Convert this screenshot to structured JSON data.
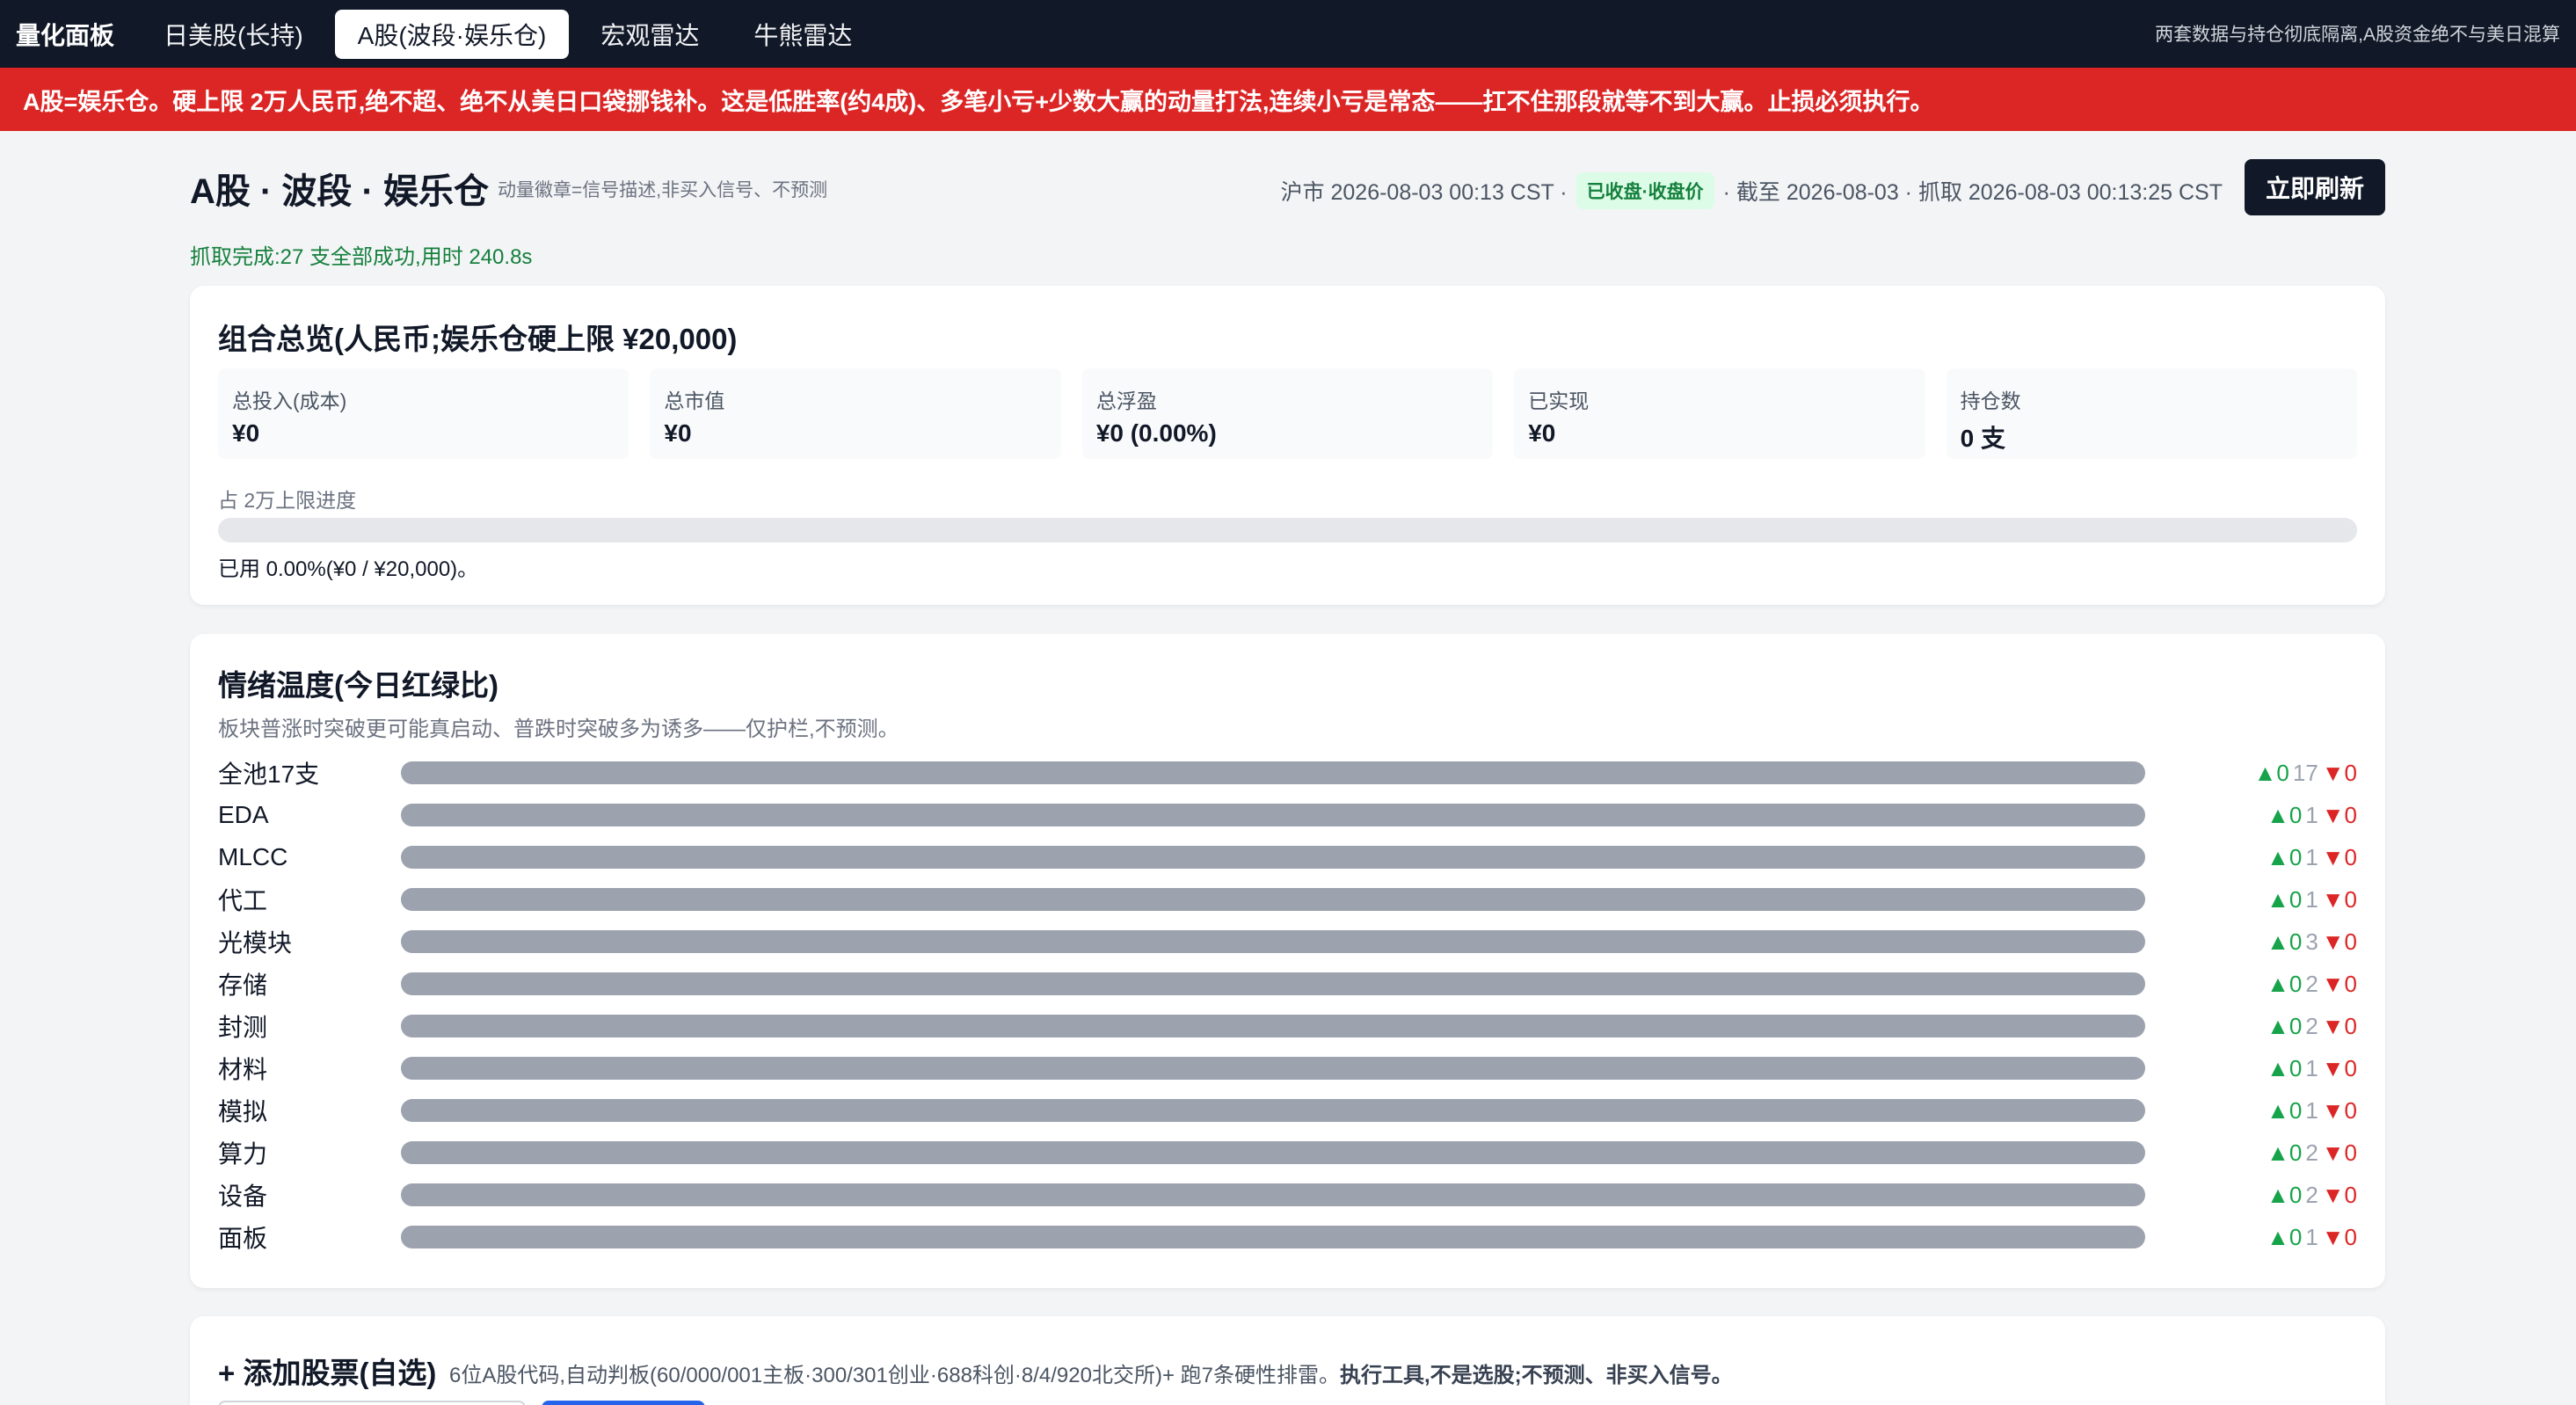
{
  "nav": {
    "brand": "量化面板",
    "tabs": [
      {
        "label": "日美股(长持)"
      },
      {
        "label": "A股(波段·娱乐仓)"
      },
      {
        "label": "宏观雷达"
      },
      {
        "label": "牛熊雷达"
      }
    ],
    "active_tab": "A股(波段·娱乐仓)",
    "note": "两套数据与持仓彻底隔离,A股资金绝不与美日混算"
  },
  "banner": {
    "text": "A股=娱乐仓。硬上限 2万人民币,绝不超、绝不从美日口袋挪钱补。这是低胜率(约4成)、多笔小亏+少数大赢的动量打法,连续小亏是常态——扛不住那段就等不到大赢。止损必须执行。"
  },
  "header": {
    "title": "A股 · 波段 · 娱乐仓",
    "subtitle": "动量徽章=信号描述,非买入信号、不预测",
    "market_time": "沪市 2026-08-03 00:13 CST ·",
    "market_status": "已收盘·收盘价",
    "as_of": "· 截至 2026-08-03 · 抓取 2026-08-03 00:13:25 CST",
    "refresh_label": "立即刷新",
    "fetch_status": "抓取完成:27 支全部成功,用时 240.8s"
  },
  "portfolio": {
    "title": "组合总览(人民币;娱乐仓硬上限 ¥20,000)",
    "stats": [
      {
        "label": "总投入(成本)",
        "value": "¥0"
      },
      {
        "label": "总市值",
        "value": "¥0"
      },
      {
        "label": "总浮盈",
        "value": "¥0 (0.00%)"
      },
      {
        "label": "已实现",
        "value": "¥0"
      },
      {
        "label": "持仓数",
        "value": "0 支"
      }
    ],
    "progress_label": "占 2万上限进度",
    "progress_fraction": 0.0,
    "progress_note": "已用 0.00%(¥0 / ¥20,000)。"
  },
  "sentiment": {
    "title": "情绪温度(今日红绿比)",
    "subtitle": "板块普涨时突破更可能真启动、普跌时突破多为诱多——仅护栏,不预测。",
    "rows": [
      {
        "label": "全池17支",
        "up": "▲0",
        "flat": "17",
        "down": "▼0"
      },
      {
        "label": "EDA",
        "up": "▲0",
        "flat": "1",
        "down": "▼0"
      },
      {
        "label": "MLCC",
        "up": "▲0",
        "flat": "1",
        "down": "▼0"
      },
      {
        "label": "代工",
        "up": "▲0",
        "flat": "1",
        "down": "▼0"
      },
      {
        "label": "光模块",
        "up": "▲0",
        "flat": "3",
        "down": "▼0"
      },
      {
        "label": "存储",
        "up": "▲0",
        "flat": "2",
        "down": "▼0"
      },
      {
        "label": "封测",
        "up": "▲0",
        "flat": "2",
        "down": "▼0"
      },
      {
        "label": "材料",
        "up": "▲0",
        "flat": "1",
        "down": "▼0"
      },
      {
        "label": "模拟",
        "up": "▲0",
        "flat": "1",
        "down": "▼0"
      },
      {
        "label": "算力",
        "up": "▲0",
        "flat": "2",
        "down": "▼0"
      },
      {
        "label": "设备",
        "up": "▲0",
        "flat": "2",
        "down": "▼0"
      },
      {
        "label": "面板",
        "up": "▲0",
        "flat": "1",
        "down": "▼0"
      }
    ]
  },
  "add_stock": {
    "title": "+ 添加股票(自选)",
    "desc": "6位A股代码,自动判板(60/000/001主板·300/301创业·688科创·8/4/920北交所)+ 跑7条硬性排雷。",
    "desc_bold": "执行工具,不是选股;不预测、非买入信号。"
  },
  "colors": {
    "nav_bg": "#111827",
    "banner_bg": "#dc2626",
    "up": "#16a34a",
    "down": "#dc2626",
    "neutral_bar": "#9ca3af"
  }
}
